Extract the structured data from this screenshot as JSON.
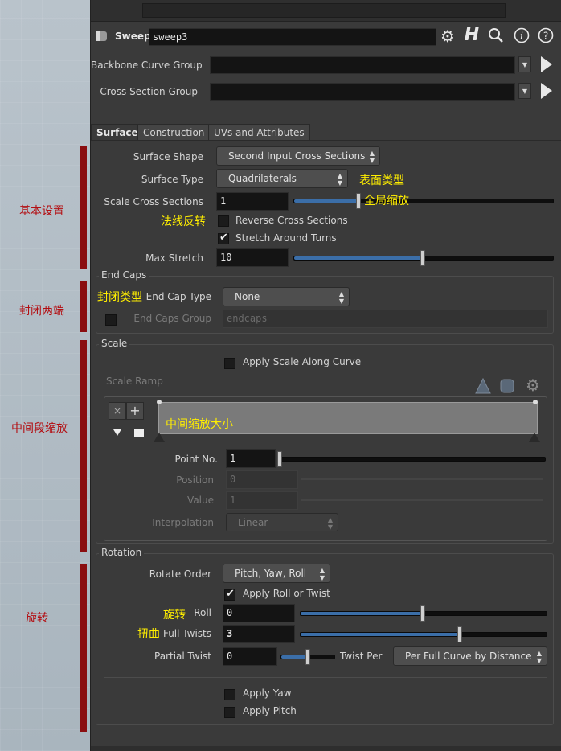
{
  "node": {
    "type_label": "Sweep",
    "name": "sweep3"
  },
  "header": {
    "backbone_label": "Backbone Curve Group",
    "cross_section_label": "Cross Section Group",
    "backbone_value": "",
    "cross_section_value": ""
  },
  "tabs": [
    "Surface",
    "Construction",
    "UVs and Attributes"
  ],
  "surface": {
    "surface_shape_label": "Surface Shape",
    "surface_shape_value": "Second Input Cross Sections",
    "surface_type_label": "Surface Type",
    "surface_type_value": "Quadrilaterals",
    "scale_cs_label": "Scale Cross Sections",
    "scale_cs_value": "1",
    "scale_cs_fraction": 0.25,
    "reverse_label": "Reverse Cross Sections",
    "reverse_checked": false,
    "stretch_label": "Stretch Around Turns",
    "stretch_checked": true,
    "max_stretch_label": "Max Stretch",
    "max_stretch_value": "10",
    "max_stretch_fraction": 0.5
  },
  "end_caps": {
    "title": "End Caps",
    "type_label": "End Cap Type",
    "type_value": "None",
    "group_label": "End Caps Group",
    "group_placeholder": "endcaps"
  },
  "scale": {
    "title": "Scale",
    "apply_label": "Apply Scale Along Curve",
    "ramp_label": "Scale Ramp",
    "point_no_label": "Point No.",
    "point_no_value": "1",
    "position_label": "Position",
    "position_value": "0",
    "value_label": "Value",
    "value_value": "1",
    "interp_label": "Interpolation",
    "interp_value": "Linear"
  },
  "rotation": {
    "title": "Rotation",
    "order_label": "Rotate Order",
    "order_value": "Pitch, Yaw, Roll",
    "apply_roll_label": "Apply Roll or Twist",
    "roll_label": "Roll",
    "roll_value": "0",
    "roll_fraction": 0.5,
    "twists_label": "Full Twists",
    "twists_value": "3",
    "twists_fraction": 0.65,
    "partial_label": "Partial Twist",
    "partial_value": "0",
    "partial_fraction": 0.5,
    "twist_per_label": "Twist Per",
    "twist_per_value": "Per Full Curve by Distance",
    "apply_yaw_label": "Apply Yaw",
    "apply_pitch_label": "Apply Pitch"
  },
  "annotations": {
    "basic": "基本设置",
    "caps": "封闭两端",
    "mid_scale": "中间段缩放",
    "rotation": "旋转",
    "surface_type": "表面类型",
    "global_scale": "全局缩放",
    "normal_flip": "法线反转",
    "cap_type": "封闭类型",
    "ramp_size": "中间缩放大小",
    "rotate": "旋转",
    "twist": "扭曲"
  },
  "colors": {
    "annotation_yellow": "#ffee00",
    "annotation_red": "#b30e12",
    "slider_fill": "#3b6ea8"
  }
}
